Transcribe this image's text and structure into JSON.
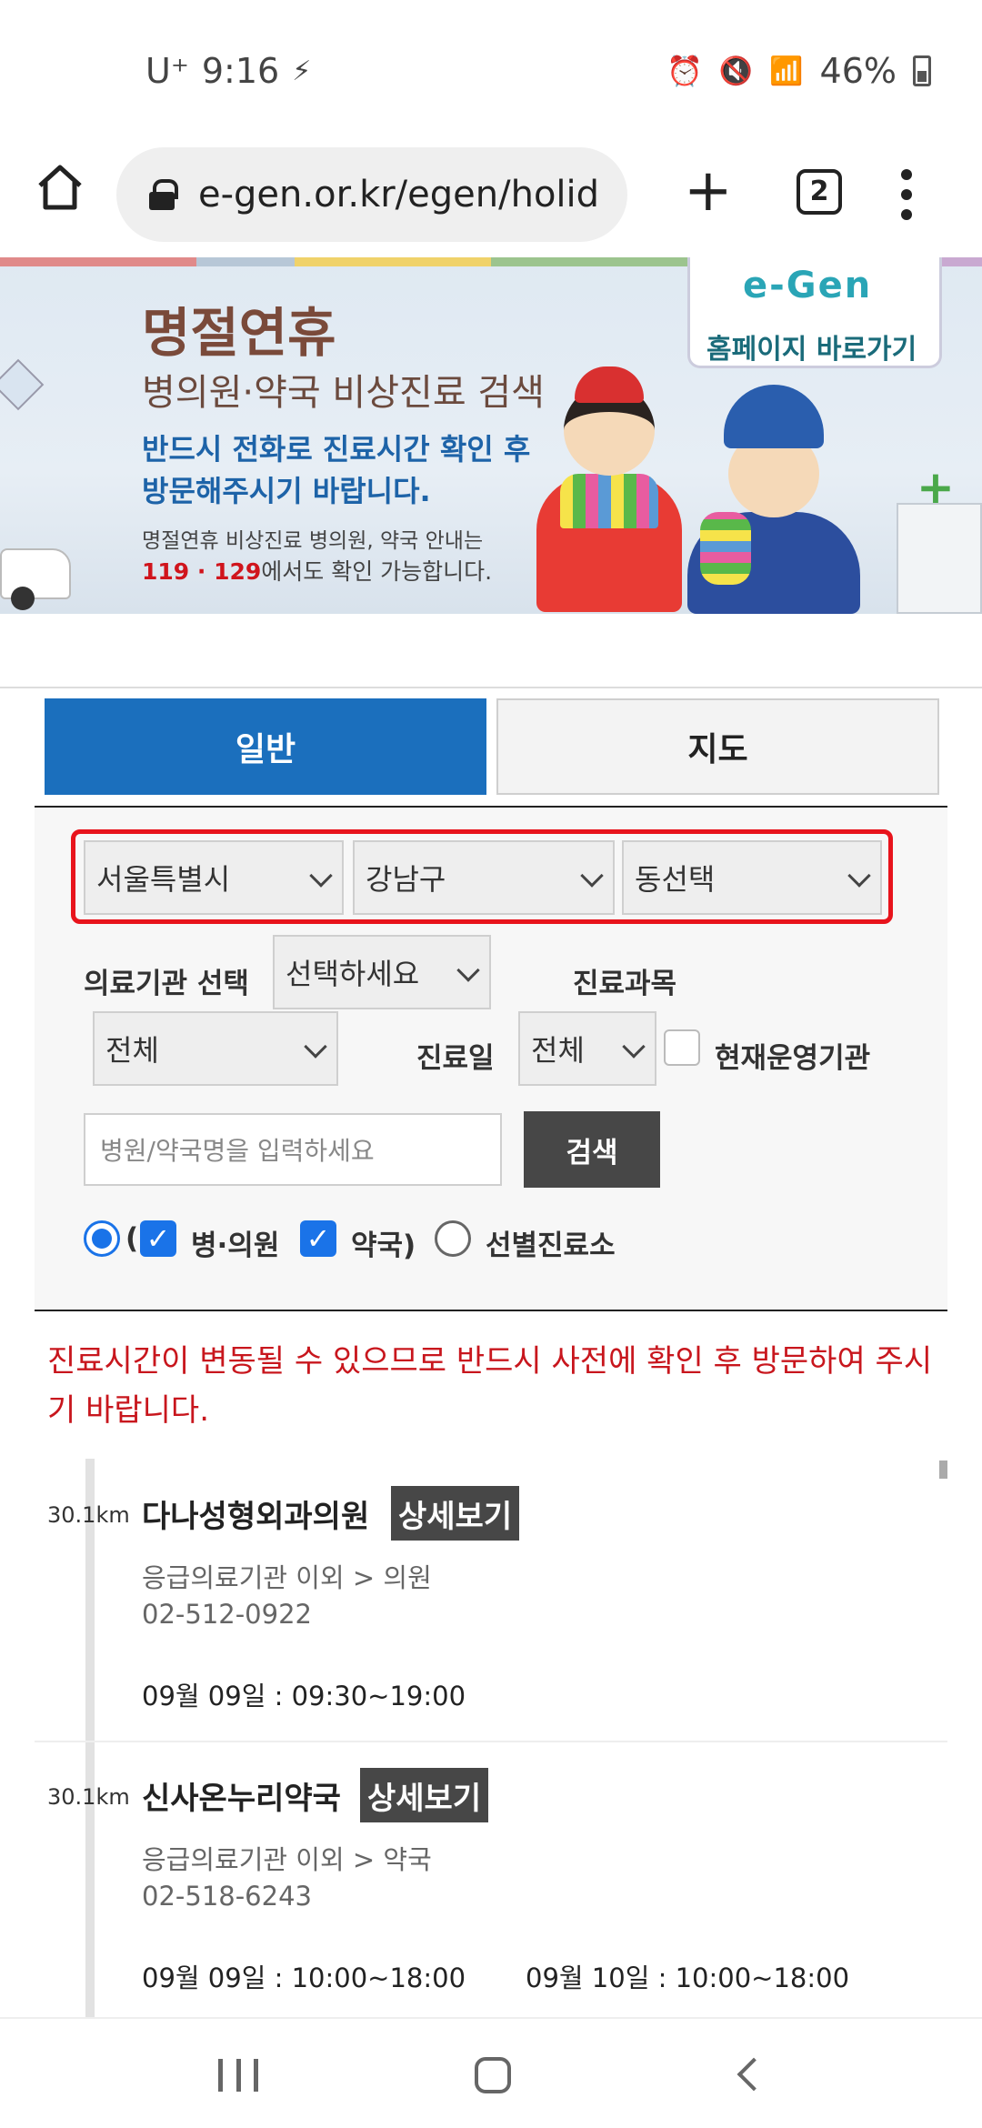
{
  "status_bar": {
    "carrier": "U⁺",
    "time": "9:16",
    "battery": "46%"
  },
  "browser": {
    "url": "e-gen.or.kr/egen/holid",
    "tab_count": "2"
  },
  "banner": {
    "title": "명절연휴",
    "subtitle": "병의원·약국 비상진료 검색",
    "notice_line1": "반드시 전화로 진료시간 확인 후",
    "notice_line2": "방문해주시기 바랍니다.",
    "info_line1": "명절연휴 비상진료 병의원, 약국 안내는",
    "info_numbers": "119 · 129",
    "info_line2_suffix": "에서도 확인 가능합니다.",
    "logo_text": "e-Gen",
    "homepage_link": "홈페이지 바로가기"
  },
  "tabs": {
    "general": "일반",
    "map": "지도"
  },
  "search": {
    "city": "서울특별시",
    "district": "강남구",
    "dong": "동선택",
    "institution_label": "의료기관 선택",
    "institution_value": "선택하세요",
    "department_label": "진료과목",
    "department_value": "전체",
    "date_label": "진료일",
    "date_value": "전체",
    "operating_label": "현재운영기관",
    "name_placeholder": "병원/약국명을 입력하세요",
    "search_button": "검색",
    "paren_open": "(",
    "option_clinic": "병·의원",
    "option_pharmacy": "약국)",
    "option_screening": "선별진료소"
  },
  "notice": "진료시간이 변동될 수 있으므로 반드시 사전에 확인 후 방문하여 주시기 바랍니다.",
  "results": [
    {
      "distance": "30.1km",
      "name": "다나성형외과의원",
      "detail": "상세보기",
      "category": "응급의료기관 이외 > 의원",
      "phone": "02-512-0922",
      "hours": [
        "09월 09일 : 09:30~19:00"
      ]
    },
    {
      "distance": "30.1km",
      "name": "신사온누리약국",
      "detail": "상세보기",
      "category": "응급의료기관 이외 > 약국",
      "phone": "02-518-6243",
      "hours": [
        "09월 09일 : 10:00~18:00",
        "09월 10일 : 10:00~18:00"
      ]
    }
  ],
  "colors": {
    "primary_blue": "#1b6fbd",
    "alert_red": "#c8161d",
    "region_highlight": "#e8141c",
    "dark_button": "#474747"
  }
}
